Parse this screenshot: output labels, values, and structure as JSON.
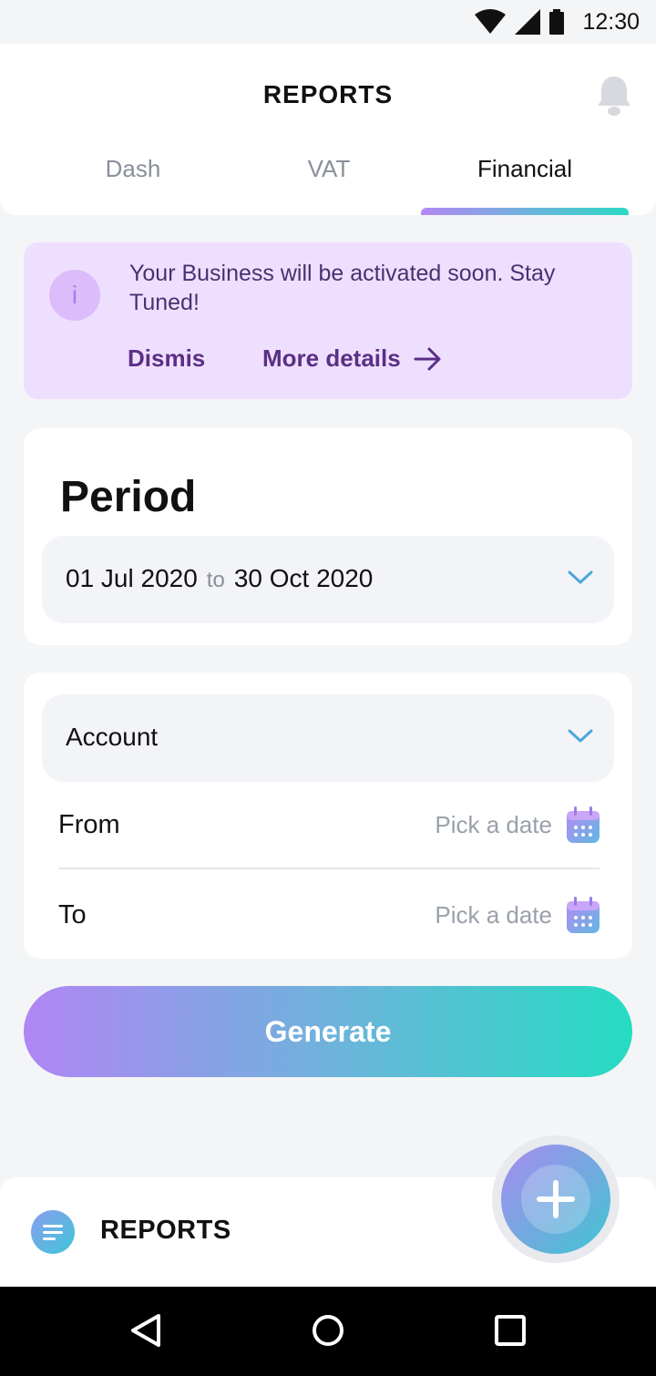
{
  "status_bar": {
    "time": "12:30"
  },
  "header": {
    "title": "REPORTS",
    "tabs": [
      {
        "label": "Dash",
        "active": false
      },
      {
        "label": "VAT",
        "active": false
      },
      {
        "label": "Financial",
        "active": true
      }
    ]
  },
  "banner": {
    "message": "Your Business will be activated soon. Stay Tuned!",
    "icon_letter": "i",
    "dismiss_label": "Dismis",
    "more_label": "More details"
  },
  "period": {
    "label": "Period",
    "start_date": "01 Jul 2020",
    "to_word": "to",
    "end_date": "30 Oct 2020"
  },
  "account_filter": {
    "account_label": "Account",
    "from_label": "From",
    "to_label": "To",
    "from_placeholder": "Pick a date",
    "to_placeholder": "Pick a date"
  },
  "generate_label": "Generate",
  "bottom_bar": {
    "section_title": "REPORTS"
  },
  "colors": {
    "gradient_start": "#b086f5",
    "gradient_end": "#25dcc2",
    "banner_bg": "#efdffe",
    "banner_text": "#5a2f86",
    "chevron": "#4aa8d8"
  },
  "icons": [
    "wifi-icon",
    "signal-icon",
    "battery-icon",
    "bell-icon",
    "info-icon",
    "arrow-right-icon",
    "chevron-down-icon",
    "calendar-icon",
    "menu-icon",
    "plus-icon",
    "back-icon",
    "home-icon",
    "recents-icon"
  ]
}
